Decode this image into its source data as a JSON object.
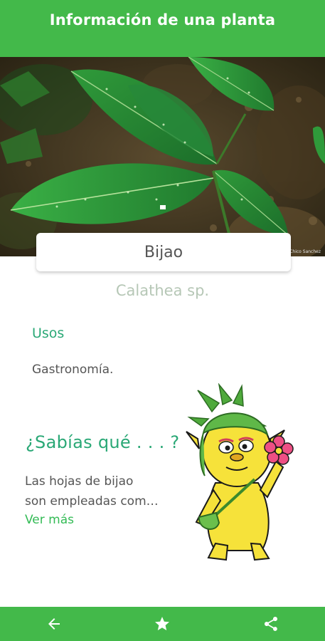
{
  "app_bar": {
    "title": "Información de una planta"
  },
  "hero": {
    "photo_credit": "Chico Sanchez",
    "image_subject": "Calathea plant leaves"
  },
  "plant": {
    "common_name": "Bijao",
    "scientific_name": "Calathea sp."
  },
  "uses": {
    "heading": "Usos",
    "text": "Gastronomía."
  },
  "did_you_know": {
    "heading": "¿Sabías qué . . . ?",
    "text_line1": "Las hojas de bijao",
    "text_line2": "son empleadas com…",
    "more_label": "Ver más"
  },
  "bottom_nav": {
    "items": [
      {
        "icon": "back-arrow-icon"
      },
      {
        "icon": "star-icon"
      },
      {
        "icon": "share-icon"
      }
    ]
  },
  "colors": {
    "primary": "#43b94a",
    "heading_green": "#2aa876",
    "link_green": "#33bb55",
    "body_text": "#555555"
  }
}
